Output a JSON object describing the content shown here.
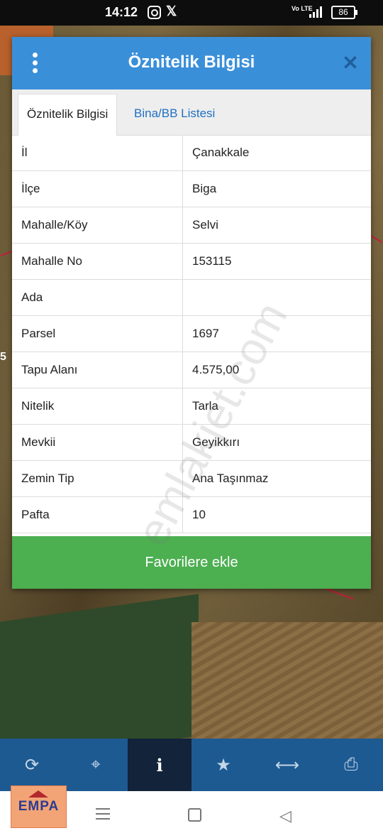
{
  "status_bar": {
    "time": "14:12",
    "x_label": "𝕏",
    "network": "Vo LTE",
    "battery": "86"
  },
  "dialog": {
    "title": "Öznitelik Bilgisi",
    "tabs": [
      {
        "label": "Öznitelik Bilgisi",
        "active": true
      },
      {
        "label": "Bina/BB Listesi",
        "active": false
      }
    ],
    "rows": [
      {
        "key": "İl",
        "value": "Çanakkale"
      },
      {
        "key": "İlçe",
        "value": "Biga"
      },
      {
        "key": "Mahalle/Köy",
        "value": "Selvi"
      },
      {
        "key": "Mahalle No",
        "value": "153115"
      },
      {
        "key": "Ada",
        "value": ""
      },
      {
        "key": "Parsel",
        "value": "1697"
      },
      {
        "key": "Tapu Alanı",
        "value": "4.575,00"
      },
      {
        "key": "Nitelik",
        "value": "Tarla"
      },
      {
        "key": "Mevkii",
        "value": "Geyikkırı"
      },
      {
        "key": "Zemin Tip",
        "value": "Ana Taşınmaz"
      },
      {
        "key": "Pafta",
        "value": "10"
      }
    ],
    "favorite_button": "Favorilere ekle"
  },
  "toolbar": {
    "items": [
      {
        "icon": "refresh-icon",
        "glyph": "⟳"
      },
      {
        "icon": "locate-icon",
        "glyph": "⌖"
      },
      {
        "icon": "info-icon",
        "glyph": "i",
        "active": true
      },
      {
        "icon": "star-icon",
        "glyph": "★"
      },
      {
        "icon": "measure-icon",
        "glyph": "⟷"
      },
      {
        "icon": "print-icon",
        "glyph": "⎙"
      }
    ]
  },
  "map": {
    "edge_label": "5"
  },
  "logo": {
    "text": "EMPA"
  },
  "watermark": "emlakjet.com",
  "colors": {
    "header": "#3a8fd9",
    "favorite_button": "#4caf50",
    "toolbar": "#1d5a92",
    "toolbar_active": "#12233a",
    "tab_link": "#1f6fc1"
  }
}
